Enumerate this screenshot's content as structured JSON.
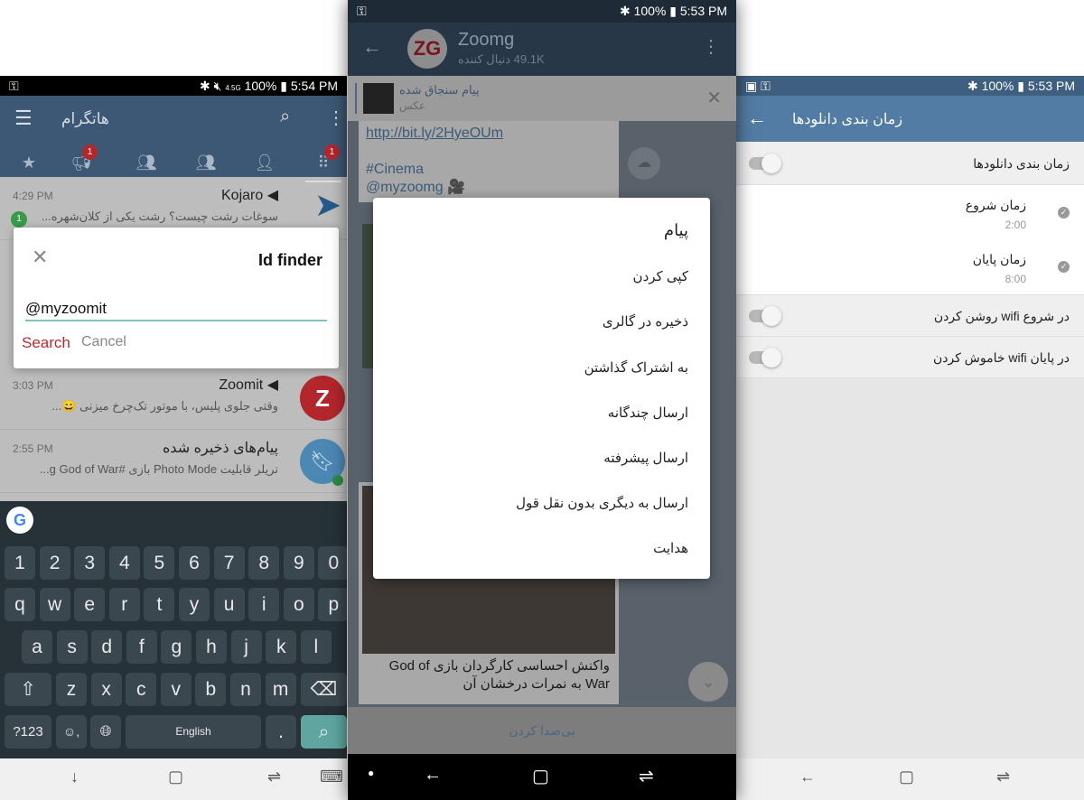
{
  "left": {
    "status": {
      "time": "5:54 PM",
      "battery": "100%",
      "network": "4.5G"
    },
    "header": {
      "title": "هاتگرام"
    },
    "tabs": [
      {
        "icon": "star-icon",
        "badge": ""
      },
      {
        "icon": "megaphone-icon",
        "badge": "1"
      },
      {
        "icon": "groups-icon",
        "badge": ""
      },
      {
        "icon": "people-icon",
        "badge": ""
      },
      {
        "icon": "person-icon",
        "badge": ""
      },
      {
        "icon": "grid-icon",
        "badge": "1"
      }
    ],
    "chats": [
      {
        "name": "Kojaro",
        "time": "4:29 PM",
        "message": "سوغات رشت چیست؟ رشت یکی از کلان‌شهره...",
        "unread": "1"
      },
      {
        "name": "Zoomit",
        "time": "3:03 PM",
        "message": "وقتی جلوی پلیس، با موتور تک‌چرخ میزنی 😄..."
      },
      {
        "name": "پیام‌های ذخیره شده",
        "time": "2:55 PM",
        "message": "تریلر قابلیت Photo Mode بازی #g  God of War..."
      }
    ],
    "dialog": {
      "title": "Id finder",
      "input_value": "@myzoomit",
      "search": "Search",
      "cancel": "Cancel"
    },
    "keyboard": {
      "row1": [
        "1",
        "2",
        "3",
        "4",
        "5",
        "6",
        "7",
        "8",
        "9",
        "0"
      ],
      "row2": [
        "q",
        "w",
        "e",
        "r",
        "t",
        "y",
        "u",
        "i",
        "o",
        "p"
      ],
      "row3": [
        "a",
        "s",
        "d",
        "f",
        "g",
        "h",
        "j",
        "k",
        "l"
      ],
      "row4": [
        "z",
        "x",
        "c",
        "v",
        "b",
        "n",
        "m"
      ],
      "sym": "?123",
      "space": "English",
      "period": "."
    }
  },
  "middle": {
    "status": {
      "time": "5:53 PM",
      "battery": "100%"
    },
    "header": {
      "title": "Zoomg",
      "subtitle": "49.1K دنبال کننده"
    },
    "pinned": {
      "title": "پیام سنجاق شده",
      "subtitle": "عکس"
    },
    "bubble1": {
      "link": "http://bit.ly/2HyeOUm",
      "tag": "#Cinema",
      "handle": "@myzoomg 🎥"
    },
    "bubble2": {
      "caption": "واکنش احساسی کارگردان بازی God of War به نمرات درخشان آن"
    },
    "dialog": {
      "title": "پیام",
      "items": [
        "کپی کردن",
        "ذخیره در گالری",
        "به اشتراک گذاشتن",
        "ارسال چندگانه",
        "ارسال پیشرفته",
        "ارسال به دیگری بدون نقل قول",
        "هدایت"
      ]
    },
    "mute": "بی‌صدا کردن"
  },
  "right": {
    "status": {
      "time": "5:53 PM",
      "battery": "100%"
    },
    "header": {
      "title": "زمان بندی دانلودها"
    },
    "schedule": {
      "label": "زمان بندی دانلودها",
      "enabled": false
    },
    "start": {
      "label": "زمان شروع",
      "value": "2:00"
    },
    "end": {
      "label": "زمان پایان",
      "value": "8:00"
    },
    "wifi_on": {
      "label": "روشن کردن wifi در شروع",
      "enabled": false
    },
    "wifi_off": {
      "label": "خاموش کردن wifi در پایان",
      "enabled": false
    }
  }
}
